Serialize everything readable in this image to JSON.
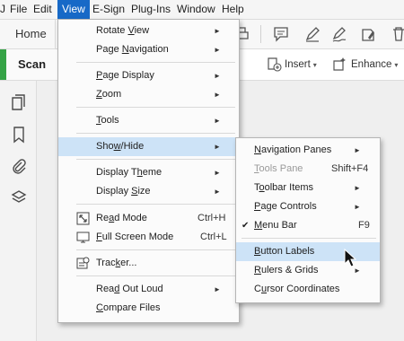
{
  "menubar": {
    "items": [
      "File",
      "Edit",
      "View",
      "E-Sign",
      "Plug-Ins",
      "Window",
      "Help"
    ],
    "edge_glyph": "J"
  },
  "toolbar": {
    "home_tab": "Home",
    "scan_tab": "Scan & ",
    "insert_label": "Insert",
    "enhance_label": "Enhance"
  },
  "view_menu": {
    "items": [
      {
        "label": "Rotate View",
        "key": "V",
        "submenu": true
      },
      {
        "label": "Page Navigation",
        "key": "N",
        "submenu": true
      },
      {
        "label": "Page Display",
        "key": "P",
        "submenu": true
      },
      {
        "label": "Zoom",
        "key": "Z",
        "submenu": true
      },
      {
        "label": "Tools",
        "key": "T",
        "submenu": true
      },
      {
        "label": "Show/Hide",
        "key": "w",
        "submenu": true
      },
      {
        "label": "Display Theme",
        "key": "h",
        "submenu": true
      },
      {
        "label": "Display Size",
        "key": "S",
        "submenu": true
      },
      {
        "label": "Read Mode",
        "key": "a",
        "shortcut": "Ctrl+H",
        "icon": "read-mode-icon"
      },
      {
        "label": "Full Screen Mode",
        "key": "F",
        "shortcut": "Ctrl+L",
        "icon": "full-screen-icon"
      },
      {
        "label": "Tracker...",
        "key": "k",
        "icon": "tracker-icon"
      },
      {
        "label": "Read Out Loud",
        "key": "d",
        "submenu": true
      },
      {
        "label": "Compare Files",
        "key": "C"
      }
    ]
  },
  "showhide_menu": {
    "items": [
      {
        "label": "Navigation Panes",
        "key": "N",
        "submenu": true
      },
      {
        "label": "Tools Pane",
        "key": "T",
        "shortcut": "Shift+F4",
        "disabled": true
      },
      {
        "label": "Toolbar Items",
        "key": "o",
        "submenu": true
      },
      {
        "label": "Page Controls",
        "key": "P",
        "submenu": true
      },
      {
        "label": "Menu Bar",
        "key": "M",
        "shortcut": "F9",
        "checked": true
      },
      {
        "label": "Button Labels",
        "key": "B"
      },
      {
        "label": "Rulers & Grids",
        "key": "R",
        "submenu": true
      },
      {
        "label": "Cursor Coordinates",
        "key": "u"
      }
    ]
  },
  "glyphs": {
    "arrow": "►",
    "check": "✔",
    "caret": "▾"
  }
}
